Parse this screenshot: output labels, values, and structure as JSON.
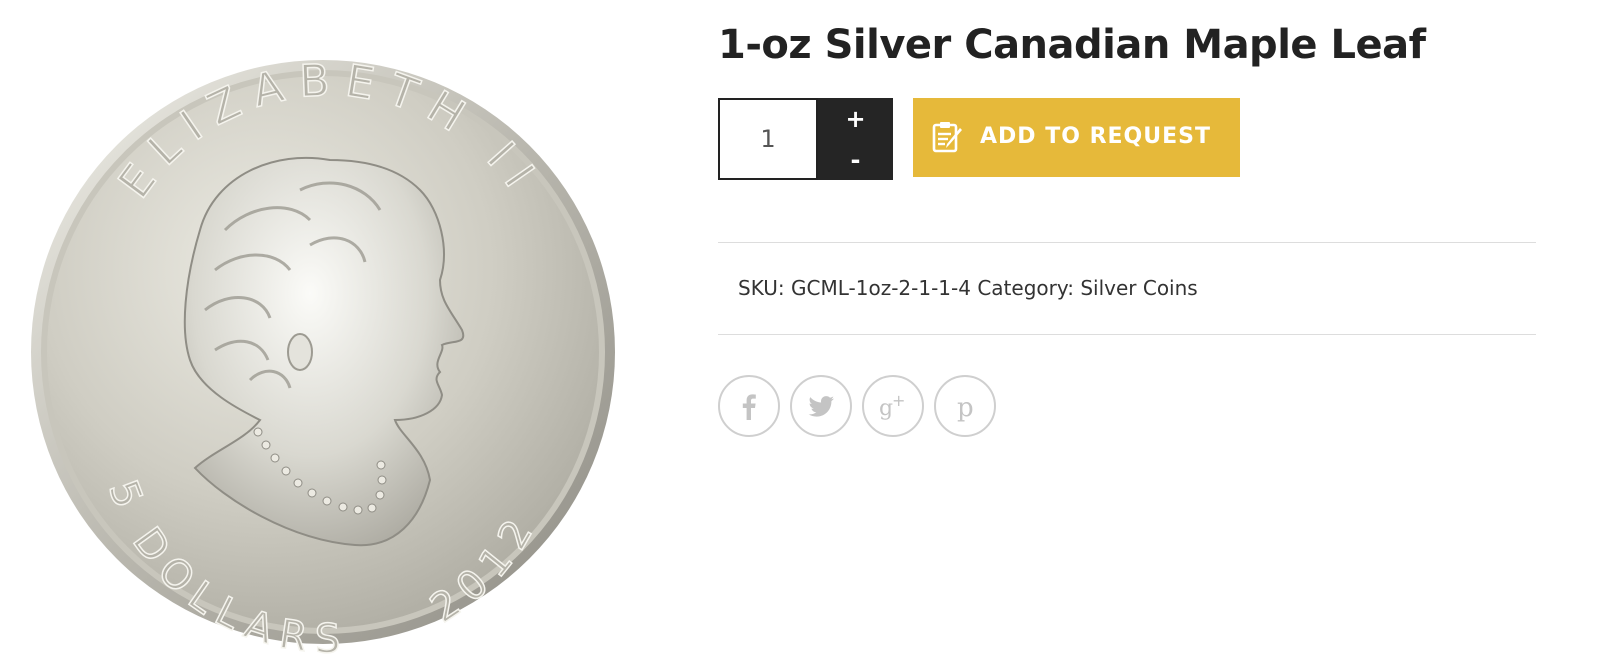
{
  "product": {
    "title": "1-oz Silver Canadian Maple Leaf",
    "image": {
      "legend_top": "ELIZABETH II",
      "legend_bottom_left": "5 DOLLARS",
      "legend_bottom_right": "2012"
    }
  },
  "cart": {
    "quantity": "1",
    "increment_label": "+",
    "decrement_label": "-",
    "add_button_label": "ADD TO REQUEST",
    "add_button_icon": "edit-document-icon",
    "accent_color": "#e6b93a"
  },
  "meta": {
    "sku_label": "SKU:",
    "sku_value": "GCML-1oz-2-1-1-4",
    "category_label": "Category:",
    "category_value": "Silver Coins"
  },
  "share": [
    {
      "network": "facebook",
      "icon": "facebook-icon"
    },
    {
      "network": "twitter",
      "icon": "twitter-icon"
    },
    {
      "network": "google-plus",
      "icon": "google-plus-icon"
    },
    {
      "network": "pinterest",
      "icon": "pinterest-icon"
    }
  ]
}
